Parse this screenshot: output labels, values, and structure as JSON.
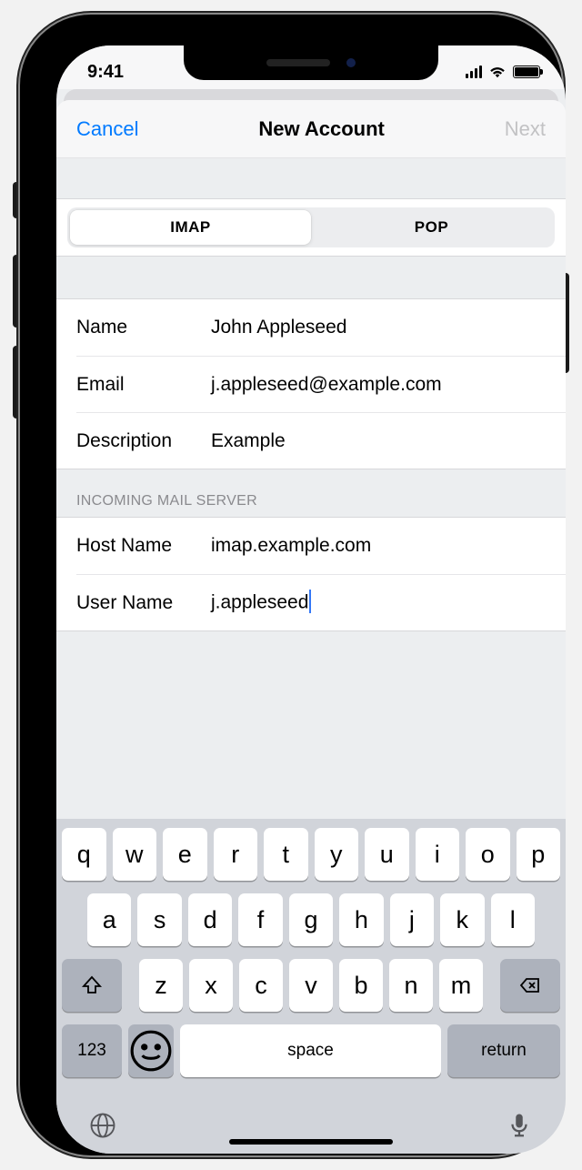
{
  "status": {
    "time": "9:41"
  },
  "nav": {
    "cancel": "Cancel",
    "title": "New Account",
    "next": "Next"
  },
  "segment": {
    "imap": "IMAP",
    "pop": "POP",
    "selected": "IMAP"
  },
  "account": {
    "name_label": "Name",
    "name_value": "John Appleseed",
    "email_label": "Email",
    "email_value": "j.appleseed@example.com",
    "description_label": "Description",
    "description_value": "Example"
  },
  "incoming": {
    "header": "INCOMING MAIL SERVER",
    "host_label": "Host Name",
    "host_value": "imap.example.com",
    "user_label": "User Name",
    "user_value": "j.appleseed"
  },
  "keyboard": {
    "row1": [
      "q",
      "w",
      "e",
      "r",
      "t",
      "y",
      "u",
      "i",
      "o",
      "p"
    ],
    "row2": [
      "a",
      "s",
      "d",
      "f",
      "g",
      "h",
      "j",
      "k",
      "l"
    ],
    "row3": [
      "z",
      "x",
      "c",
      "v",
      "b",
      "n",
      "m"
    ],
    "numbers": "123",
    "space": "space",
    "return": "return"
  }
}
